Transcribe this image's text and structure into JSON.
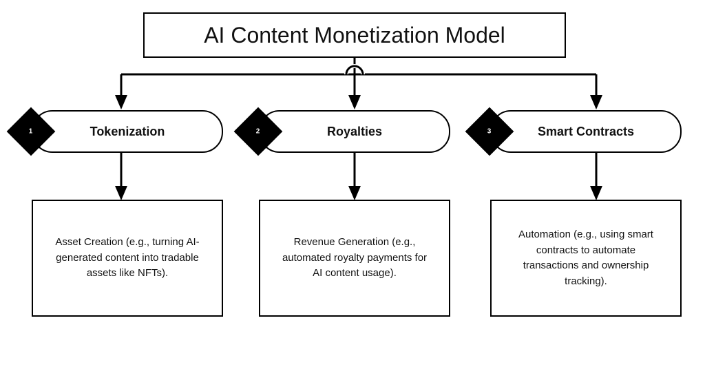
{
  "title": "AI Content Monetization Model",
  "branches": [
    {
      "number": "1",
      "label": "Tokenization",
      "description": "Asset  Creation (e.g., turning AI-generated content into tradable assets like NFTs)."
    },
    {
      "number": "2",
      "label": "Royalties",
      "description": "Revenue Generation (e.g., automated royalty payments for AI content usage)."
    },
    {
      "number": "3",
      "label": "Smart Contracts",
      "description": "Automation (e.g., using smart contracts to automate transactions and ownership tracking)."
    }
  ]
}
